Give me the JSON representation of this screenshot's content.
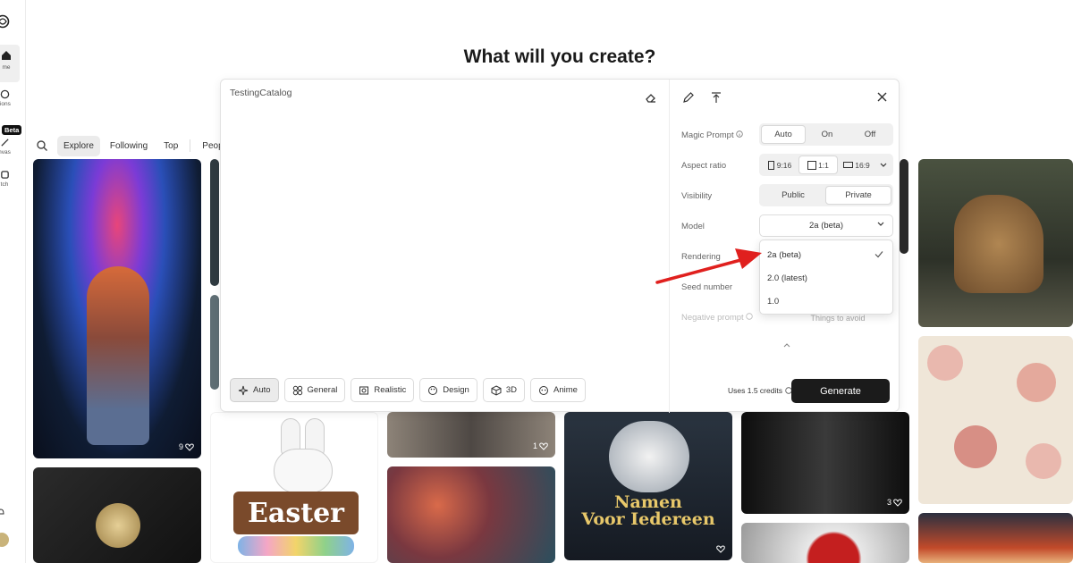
{
  "sidebar": {
    "items": [
      {
        "label": "me",
        "icon": "home-icon"
      },
      {
        "label": "tions",
        "icon": "circle-icon"
      },
      {
        "label": "nvas",
        "icon": "canvas-icon"
      },
      {
        "label": "tch",
        "icon": "sketch-icon"
      }
    ],
    "beta_badge": "Beta"
  },
  "page_title": "What will you create?",
  "filter": {
    "tabs": [
      "Explore",
      "Following",
      "Top",
      "People"
    ],
    "active_tab": "Explore"
  },
  "gallery": {
    "likes": [
      "9",
      "1",
      "3"
    ]
  },
  "modal": {
    "prompt_text": "TestingCatalog",
    "styles": [
      "Auto",
      "General",
      "Realistic",
      "Design",
      "3D",
      "Anime"
    ],
    "active_style": "Auto",
    "settings": {
      "magic_prompt": {
        "label": "Magic Prompt",
        "options": [
          "Auto",
          "On",
          "Off"
        ],
        "selected": "Auto"
      },
      "aspect_ratio": {
        "label": "Aspect ratio",
        "options": [
          "9:16",
          "1:1",
          "16:9"
        ],
        "selected": "1:1"
      },
      "visibility": {
        "label": "Visibility",
        "options": [
          "Public",
          "Private"
        ],
        "selected": "Private"
      },
      "model": {
        "label": "Model",
        "value": "2a (beta)",
        "options": [
          "2a (beta)",
          "2.0 (latest)",
          "1.0"
        ]
      },
      "rendering": {
        "label": "Rendering"
      },
      "seed": {
        "label": "Seed number"
      },
      "negative_prompt": {
        "label": "Negative prompt",
        "placeholder": "Things to avoid"
      }
    },
    "credits": "Uses 1.5 credits",
    "generate_label": "Generate"
  },
  "colors": {
    "accent_dark": "#1b1b1b",
    "annotation_arrow": "#e0201e"
  }
}
